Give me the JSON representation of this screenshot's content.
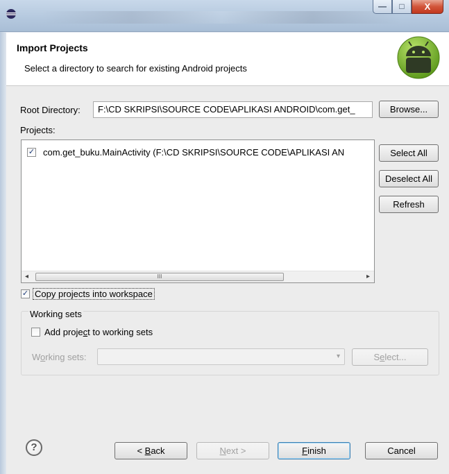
{
  "window": {
    "minimize_glyph": "—",
    "maximize_glyph": "□",
    "close_glyph": "X"
  },
  "header": {
    "title": "Import Projects",
    "description": "Select a directory to search for existing Android projects"
  },
  "root_directory": {
    "label": "Root Directory:",
    "value": "F:\\CD SKRIPSI\\SOURCE CODE\\APLIKASI ANDROID\\com.get_",
    "browse_label": "Browse..."
  },
  "projects": {
    "label": "Projects:",
    "items": [
      {
        "checked": true,
        "label": "com.get_buku.MainActivity (F:\\CD SKRIPSI\\SOURCE CODE\\APLIKASI AN"
      }
    ],
    "select_all_label": "Select All",
    "deselect_all_label": "Deselect All",
    "refresh_label": "Refresh",
    "scroll_left": "◂",
    "scroll_right": "▸",
    "scroll_grip": "III"
  },
  "copy_into_workspace": {
    "checked": true,
    "label": "Copy projects into workspace"
  },
  "working_sets": {
    "group_title": "Working sets",
    "add_label_pre": "Add proje",
    "add_label_u": "c",
    "add_label_post": "t to working sets",
    "add_checked": false,
    "field_label_pre": "W",
    "field_label_u": "o",
    "field_label_post": "rking sets:",
    "value": "",
    "caret": "▾",
    "select_pre": "S",
    "select_u": "e",
    "select_post": "lect..."
  },
  "footer": {
    "help_glyph": "?",
    "back_pre": "< ",
    "back_u": "B",
    "back_post": "ack",
    "next_u": "N",
    "next_post": "ext >",
    "finish_u": "F",
    "finish_post": "inish",
    "cancel_label": "Cancel"
  },
  "colors": {
    "accent": "#3c7fb1",
    "android_green": "#8cc63f"
  }
}
